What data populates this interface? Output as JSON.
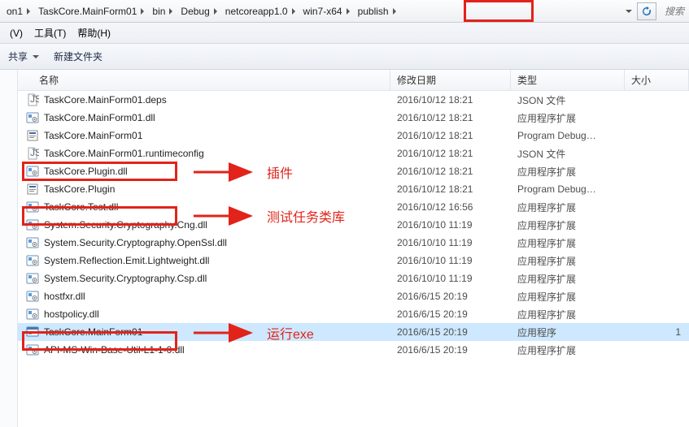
{
  "breadcrumb": {
    "items": [
      "on1",
      "TaskCore.MainForm01",
      "bin",
      "Debug",
      "netcoreapp1.0",
      "win7-x64",
      "publish"
    ],
    "search_placeholder": "搜索"
  },
  "menubar": {
    "items": [
      {
        "label": "(V)"
      },
      {
        "label": "工具(T)"
      },
      {
        "label": "帮助(H)"
      }
    ]
  },
  "toolbar": {
    "share": "共享",
    "new_folder": "新建文件夹"
  },
  "columns": {
    "name": "名称",
    "date": "修改日期",
    "type": "类型",
    "size": "大小"
  },
  "files": [
    {
      "icon": "json",
      "name": "TaskCore.MainForm01.deps",
      "date": "2016/10/12 18:21",
      "type": "JSON 文件",
      "size": ""
    },
    {
      "icon": "dll",
      "name": "TaskCore.MainForm01.dll",
      "date": "2016/10/12 18:21",
      "type": "应用程序扩展",
      "size": ""
    },
    {
      "icon": "pdb",
      "name": "TaskCore.MainForm01",
      "date": "2016/10/12 18:21",
      "type": "Program Debug…",
      "size": ""
    },
    {
      "icon": "json",
      "name": "TaskCore.MainForm01.runtimeconfig",
      "date": "2016/10/12 18:21",
      "type": "JSON 文件",
      "size": ""
    },
    {
      "icon": "dll",
      "name": "TaskCore.Plugin.dll",
      "date": "2016/10/12 18:21",
      "type": "应用程序扩展",
      "size": ""
    },
    {
      "icon": "pdb",
      "name": "TaskCore.Plugin",
      "date": "2016/10/12 18:21",
      "type": "Program Debug…",
      "size": ""
    },
    {
      "icon": "dll",
      "name": "TaskCore.Test.dll",
      "date": "2016/10/12 16:56",
      "type": "应用程序扩展",
      "size": ""
    },
    {
      "icon": "dll",
      "name": "System.Security.Cryptography.Cng.dll",
      "date": "2016/10/10 11:19",
      "type": "应用程序扩展",
      "size": ""
    },
    {
      "icon": "dll",
      "name": "System.Security.Cryptography.OpenSsl.dll",
      "date": "2016/10/10 11:19",
      "type": "应用程序扩展",
      "size": ""
    },
    {
      "icon": "dll",
      "name": "System.Reflection.Emit.Lightweight.dll",
      "date": "2016/10/10 11:19",
      "type": "应用程序扩展",
      "size": ""
    },
    {
      "icon": "dll",
      "name": "System.Security.Cryptography.Csp.dll",
      "date": "2016/10/10 11:19",
      "type": "应用程序扩展",
      "size": ""
    },
    {
      "icon": "dll",
      "name": "hostfxr.dll",
      "date": "2016/6/15 20:19",
      "type": "应用程序扩展",
      "size": ""
    },
    {
      "icon": "dll",
      "name": "hostpolicy.dll",
      "date": "2016/6/15 20:19",
      "type": "应用程序扩展",
      "size": ""
    },
    {
      "icon": "exe",
      "name": "TaskCore.MainForm01",
      "date": "2016/6/15 20:19",
      "type": "应用程序",
      "size": "1",
      "selected": true
    },
    {
      "icon": "dll",
      "name": "API-MS-Win-Base-Util-L1-1-0.dll",
      "date": "2016/6/15 20:19",
      "type": "应用程序扩展",
      "size": ""
    }
  ],
  "annotations": {
    "plugin": "插件",
    "test_lib": "测试任务类库",
    "run_exe": "运行exe"
  }
}
